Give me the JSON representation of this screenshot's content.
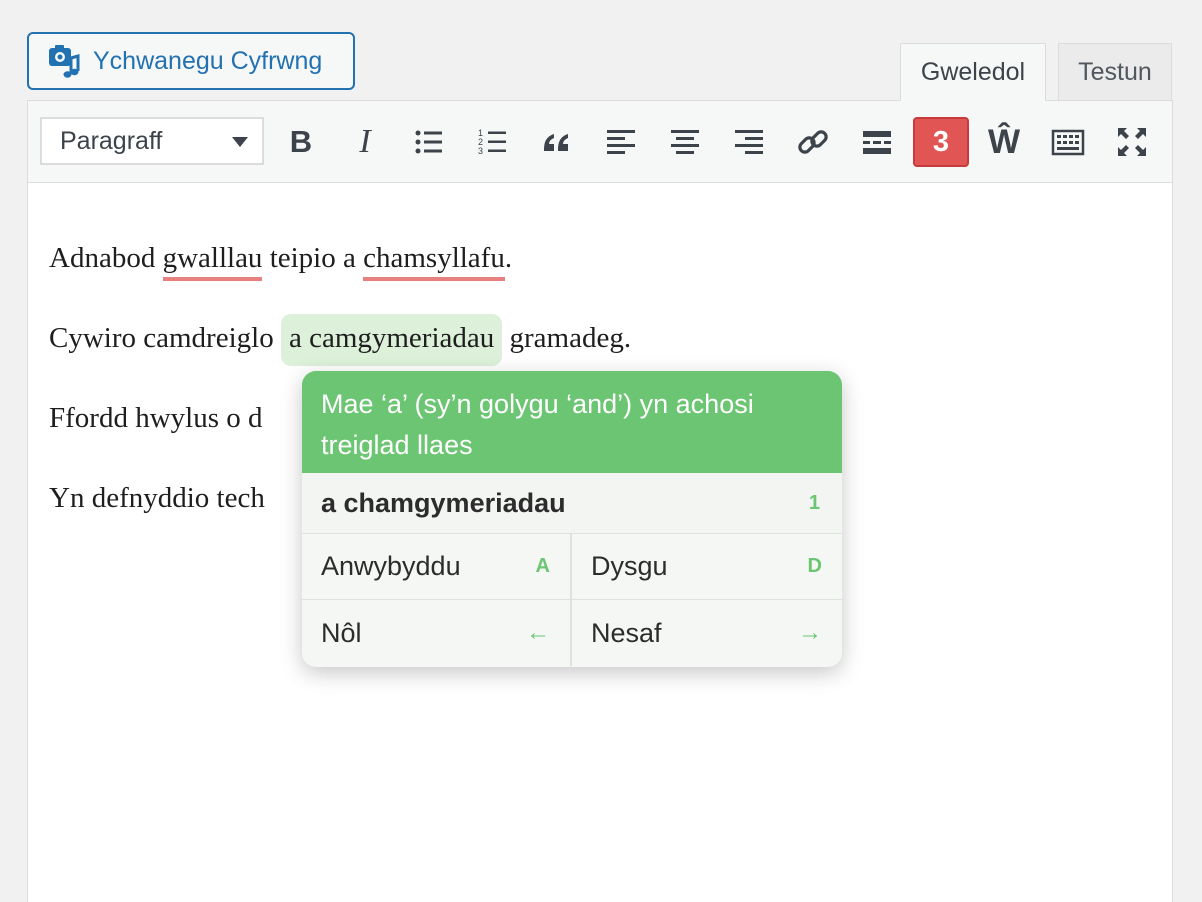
{
  "media_button": {
    "label": "Ychwanegu Cyfrwng",
    "icon": "media-icon"
  },
  "tabs": [
    {
      "label": "Gweledol",
      "active": true
    },
    {
      "label": "Testun",
      "active": false
    }
  ],
  "toolbar": {
    "format": "Paragraff",
    "badge_count": "3",
    "buttons": [
      "bold-icon",
      "italic-icon",
      "bullet-list-icon",
      "numbered-list-icon",
      "blockquote-icon",
      "align-left-icon",
      "align-center-icon",
      "align-right-icon",
      "link-icon",
      "read-more-icon",
      "cysill-icon",
      "toolbar-toggle-icon",
      "fullscreen-icon"
    ],
    "italic_glyph": "I",
    "bold_glyph": "B",
    "w_glyph": "Ŵ"
  },
  "editor": {
    "p1": {
      "a": "Adnabod ",
      "err1": "gwalllau",
      "b": " teipio a ",
      "err2": "chamsyllafu",
      "c": "."
    },
    "p2": {
      "a": "Cywiro camdreiglo",
      "grammar": "a camgymeriadau",
      "b": " gramadeg."
    },
    "p3": "Ffordd hwylus o d",
    "p4": "Yn defnyddio tech"
  },
  "popup": {
    "message": "Mae ‘a’ (sy’n golygu ‘and’) yn achosi treiglad llaes",
    "suggestion": "a chamgymeriadau",
    "suggestion_key": "1",
    "actions": [
      {
        "label": "Anwybyddu",
        "key": "A"
      },
      {
        "label": "Dysgu",
        "key": "D"
      },
      {
        "label": "Nôl",
        "key": "←"
      },
      {
        "label": "Nesaf",
        "key": "→"
      }
    ]
  },
  "colors": {
    "accent": "#2271b1",
    "error_underline": "#e98080",
    "grammar_highlight": "#dcf0da",
    "popup_green": "#6cc572",
    "badge_red": "#e25555"
  }
}
